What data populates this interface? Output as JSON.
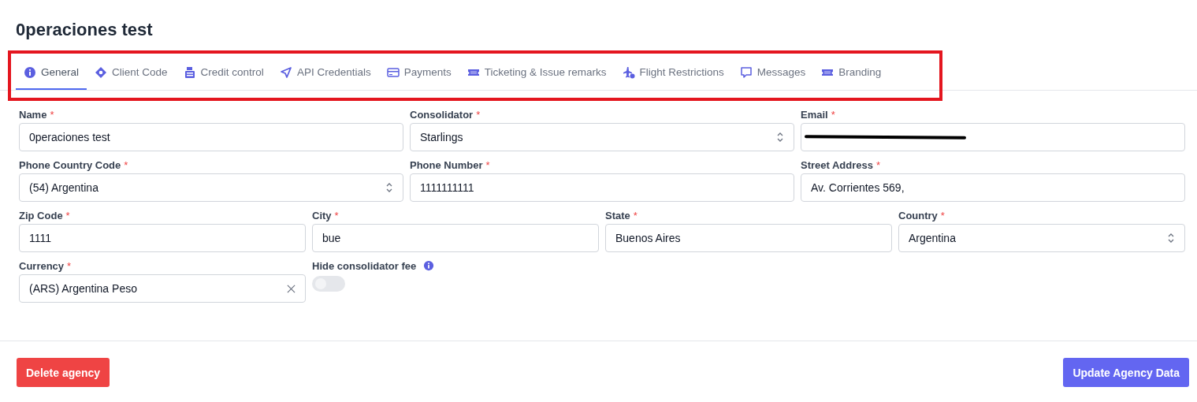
{
  "title": "0peraciones test",
  "tabs": [
    {
      "label": "General",
      "kind": "info",
      "selected": true
    },
    {
      "label": "Client Code",
      "kind": "diamond",
      "selected": false
    },
    {
      "label": "Credit control",
      "kind": "register",
      "selected": false
    },
    {
      "label": "API Credentials",
      "kind": "send",
      "selected": false
    },
    {
      "label": "Payments",
      "kind": "card",
      "selected": false
    },
    {
      "label": "Ticketing & Issue remarks",
      "kind": "ticket",
      "selected": false
    },
    {
      "label": "Flight Restrictions",
      "kind": "plane",
      "selected": false
    },
    {
      "label": "Messages",
      "kind": "chat",
      "selected": false
    },
    {
      "label": "Branding",
      "kind": "ticket",
      "selected": false
    }
  ],
  "rows": [
    {
      "fields": [
        {
          "label": "Name",
          "required_mark": "*",
          "kind": "text",
          "value": "0peraciones test"
        },
        {
          "label": "Consolidator",
          "required_mark": "*",
          "kind": "select",
          "value": "Starlings"
        },
        {
          "label": "Email",
          "required_mark": "*",
          "kind": "redacted"
        }
      ]
    },
    {
      "fields": [
        {
          "label": "Phone Country Code",
          "required_mark": "*",
          "kind": "select",
          "value": "(54) Argentina"
        },
        {
          "label": "Phone Number",
          "required_mark": "*",
          "kind": "text",
          "value": "1111111111"
        },
        {
          "label": "Street Address",
          "required_mark": "*",
          "kind": "text",
          "value": "Av. Corrientes 569,"
        }
      ]
    },
    {
      "fields": [
        {
          "label": "Zip Code",
          "required_mark": "*",
          "kind": "text",
          "value": "1111"
        },
        {
          "label": "City",
          "required_mark": "*",
          "kind": "text",
          "value": "bue"
        },
        {
          "label": "State",
          "required_mark": "*",
          "kind": "text",
          "value": "Buenos Aires"
        },
        {
          "label": "Country",
          "required_mark": "*",
          "kind": "select",
          "value": "Argentina"
        }
      ]
    },
    {
      "fields": [
        {
          "label": "Currency",
          "required_mark": "*",
          "kind": "clearable",
          "value": "(ARS) Argentina Peso"
        },
        {
          "label": "Hide consolidator fee",
          "kind": "toggle",
          "on": false
        }
      ]
    }
  ],
  "buttons": {
    "delete": "Delete agency",
    "update": "Update Agency Data"
  }
}
